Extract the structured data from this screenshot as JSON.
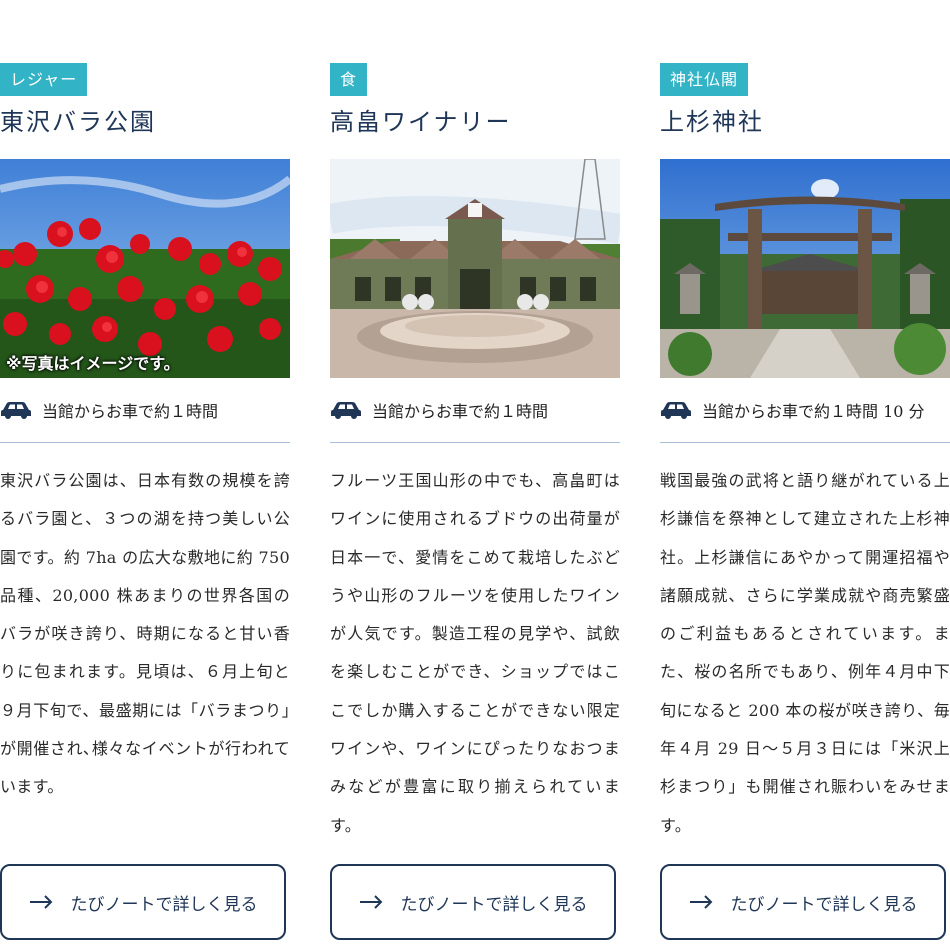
{
  "cards": [
    {
      "tag": "レジャー",
      "title": "東沢バラ公園",
      "photo_caption": "※写真はイメージです。",
      "access": "当館からお車で約１時間",
      "description": "東沢バラ公園は、日本有数の規模を誇るバラ園と、３つの湖を持つ美しい公園です。約 7ha の広大な敷地に約 750 品種、20,000 株あまりの世界各国のバラが咲き誇り、時期になると甘い香りに包まれます。見頃は、６月上旬と９月下旬で、最盛期には「バラまつり」が開催され､様々なイベントが行われています。",
      "button": "たびノートで詳しく見る"
    },
    {
      "tag": "食",
      "title": "高畠ワイナリー",
      "access": "当館からお車で約１時間",
      "description": "フルーツ王国山形の中でも、高畠町はワインに使用されるブドウの出荷量が日本一で、愛情をこめて栽培したぶどうや山形のフルーツを使用したワインが人気です。製造工程の見学や、試飲を楽しむことができ、ショップではここでしか購入することができない限定ワインや、ワインにぴったりなおつまみなどが豊富に取り揃えられています。",
      "button": "たびノートで詳しく見る"
    },
    {
      "tag": "神社仏閣",
      "title": "上杉神社",
      "access": "当館からお車で約１時間 10 分",
      "description": "戦国最強の武将と語り継がれている上杉謙信を祭神として建立された上杉神社。上杉謙信にあやかって開運招福や諸願成就、さらに学業成就や商売繁盛のご利益もあるとされています。また、桜の名所でもあり、例年４月中下旬になると 200 本の桜が咲き誇り、毎年４月 29 日〜５月３日には「米沢上杉まつり」も開催され賑わいをみせます。",
      "button": "たびノートで詳しく見る"
    }
  ],
  "colors": {
    "tag_bg": "#32b3c6",
    "title": "#1f3657",
    "divider": "#a9bfdc",
    "button_border": "#1f3657"
  },
  "icons": {
    "access": "car-icon",
    "button": "arrow-right-icon"
  }
}
